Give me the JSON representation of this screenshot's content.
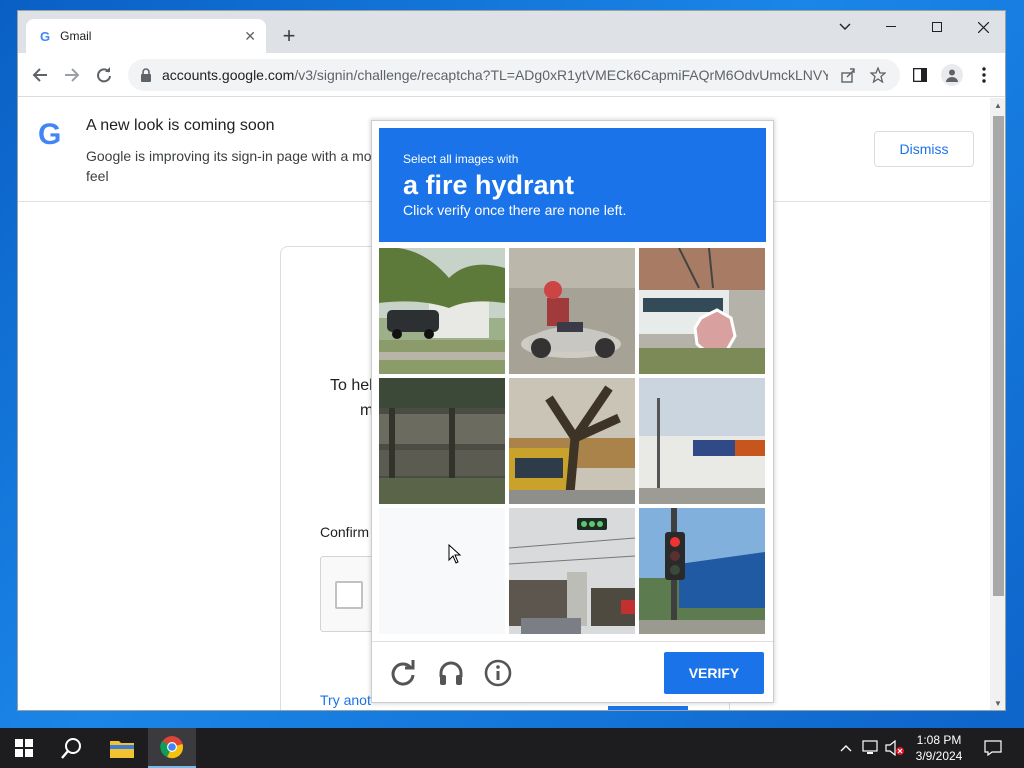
{
  "browser": {
    "tab_title": "Gmail",
    "tab_favicon": "G",
    "url_domain": "accounts.google.com",
    "url_path": "/v3/signin/challenge/recaptcha?TL=ADg0xR1ytVMECk6CapmiFAQrM6OdvUmckLNVY...",
    "icons": [
      "back-icon",
      "forward-icon",
      "reload-icon",
      "lock-icon",
      "share-icon",
      "star-icon",
      "side-panel-icon",
      "profile-icon",
      "menu-icon"
    ]
  },
  "banner": {
    "logo": "G",
    "title": "A new look is coming soon",
    "text": "Google is improving its sign-in page with a mo",
    "text2": "feel",
    "dismiss_label": "Dismiss"
  },
  "signin": {
    "help_line1": "To hel",
    "help_line2": "m",
    "confirm_label": "Confirm",
    "try_another": "Try anot"
  },
  "challenge": {
    "prompt_small": "Select all images with",
    "prompt_target": "a fire hydrant",
    "prompt_instruction": "Click verify once there are none left.",
    "verify_label": "VERIFY",
    "tiles": [
      {
        "name": "tile-house-car",
        "scene": "house with trees and parked car"
      },
      {
        "name": "tile-motorcycle",
        "scene": "person riding scooter"
      },
      {
        "name": "tile-stop-sign",
        "scene": "bus and stop sign"
      },
      {
        "name": "tile-fence",
        "scene": "wooden fence and grass"
      },
      {
        "name": "tile-tree-truck",
        "scene": "tree trunk and yellow truck"
      },
      {
        "name": "tile-store",
        "scene": "Storage Mart building"
      },
      {
        "name": "tile-blank",
        "scene": "blank loading tile"
      },
      {
        "name": "tile-traffic-light-street",
        "scene": "street with traffic light"
      },
      {
        "name": "tile-traffic-light-pole",
        "scene": "traffic light pole and blue building"
      }
    ]
  },
  "taskbar": {
    "time": "1:08 PM",
    "date": "3/9/2024"
  },
  "colors": {
    "accent": "#1a73e8",
    "desktop": "#0a5fc4",
    "taskbar": "#1d1d1f"
  }
}
